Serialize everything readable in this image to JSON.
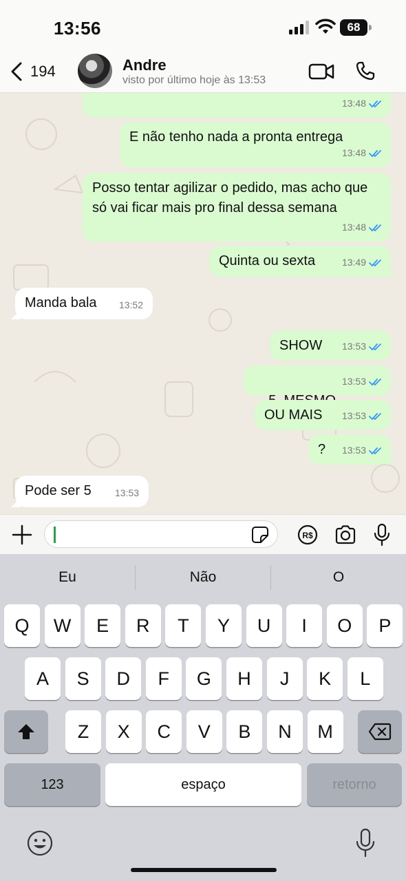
{
  "status_bar": {
    "time": "13:56",
    "battery": "68"
  },
  "header": {
    "back_count": "194",
    "contact_name": "Andre",
    "last_seen": "visto por último hoje às 13:53"
  },
  "messages": [
    {
      "dir": "out",
      "text": "",
      "time": "13:48"
    },
    {
      "dir": "out",
      "text": "E não tenho nada a pronta entrega",
      "time": "13:48"
    },
    {
      "dir": "out",
      "text": "Posso tentar agilizar o pedido, mas acho que só vai ficar mais pro final dessa semana",
      "time": "13:48"
    },
    {
      "dir": "out",
      "text": "Quinta ou sexta",
      "time": "13:49"
    },
    {
      "dir": "in",
      "text": "Manda bala",
      "time": "13:52"
    },
    {
      "dir": "out",
      "text": "SHOW",
      "time": "13:53"
    },
    {
      "dir": "out",
      "text": "5  MESMO",
      "time": "13:53"
    },
    {
      "dir": "out",
      "text": "OU MAIS",
      "time": "13:53"
    },
    {
      "dir": "out",
      "text": "?",
      "time": "13:53"
    },
    {
      "dir": "in",
      "text": "Pode ser 5",
      "time": "13:53"
    }
  ],
  "keyboard": {
    "suggestions": [
      "Eu",
      "Não",
      "O"
    ],
    "row1": [
      "Q",
      "W",
      "E",
      "R",
      "T",
      "Y",
      "U",
      "I",
      "O",
      "P"
    ],
    "row2": [
      "A",
      "S",
      "D",
      "F",
      "G",
      "H",
      "J",
      "K",
      "L"
    ],
    "row3": [
      "Z",
      "X",
      "C",
      "V",
      "B",
      "N",
      "M"
    ],
    "numbers_key": "123",
    "space_key": "espaço",
    "return_key": "retorno"
  },
  "icons": {
    "back": "chevron-left-icon",
    "video": "video-call-icon",
    "phone": "phone-icon",
    "plus": "plus-icon",
    "sticker": "sticker-icon",
    "pix": "pix-payment-icon",
    "camera": "camera-icon",
    "mic": "microphone-icon",
    "emoji": "emoji-icon",
    "shift": "shift-icon",
    "backspace": "backspace-icon"
  },
  "colors": {
    "outgoing_bubble": "#dafbd0",
    "incoming_bubble": "#ffffff",
    "read_ticks": "#3497f9",
    "chat_background": "#efeae2"
  }
}
